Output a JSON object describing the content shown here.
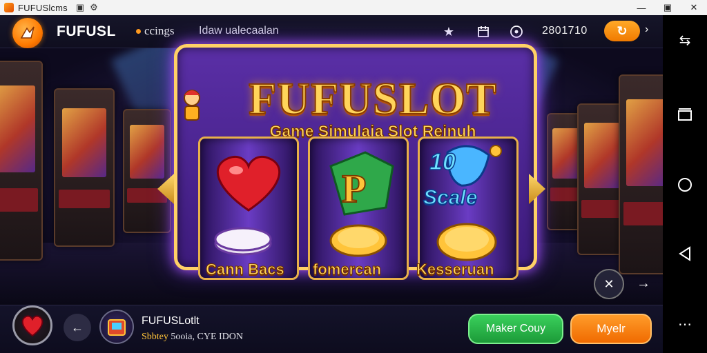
{
  "window": {
    "title": "FUFUSlcms",
    "title_icons": [
      "save-icon",
      "settings-icon"
    ],
    "controls": [
      "minimize-icon",
      "maximize-icon",
      "close-icon"
    ]
  },
  "header": {
    "brand": "FUFUSL",
    "brand_sub": "ccings",
    "nav_link": "Idaw ualecaalan",
    "icons": [
      "star-icon",
      "calendar-icon",
      "info-icon"
    ],
    "coin_amount": "2801710",
    "coin_button_icon": "refresh-icon"
  },
  "game": {
    "title": "FUFUSLOT",
    "subtitle": "Game Simulaia  Slot Reinuh",
    "reels": [
      {
        "symbol": "heart",
        "label": "Cann Bacs"
      },
      {
        "symbol": "green-p",
        "label": "fomercan"
      },
      {
        "symbol": "blue-scale",
        "label": "Kesseruan",
        "symbol_text": "Scale"
      }
    ],
    "reel_badge": "10",
    "controls": [
      "shuffle-icon",
      "next-icon"
    ]
  },
  "footer": {
    "game_name": "FUFUSLotlt",
    "stats_highlight": "Sbbtey",
    "stats_rest": " 5ooia,  CYE IDON",
    "primary_button": "Maker Couy",
    "secondary_button": "Myelr"
  },
  "navbar": {
    "icons": [
      "nav-switch-icon",
      "recents-icon",
      "home-icon",
      "back-icon",
      "more-icon"
    ]
  },
  "colors": {
    "accent_orange": "#ff8a00",
    "gold": "#ffd45a",
    "machine_purple": "#4a22a0",
    "green": "#2fc24e"
  }
}
